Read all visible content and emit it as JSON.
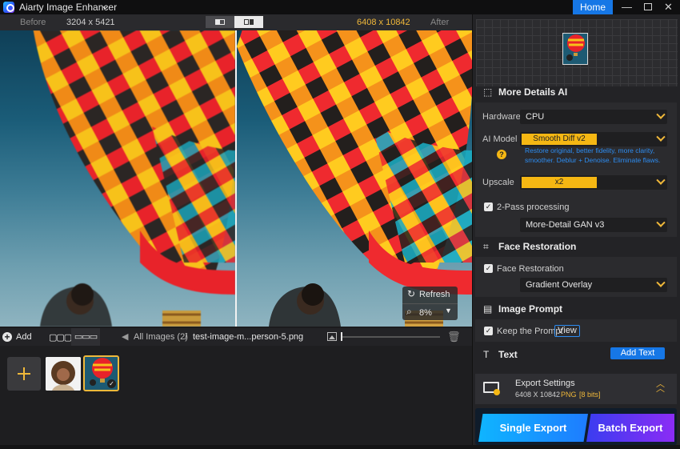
{
  "window": {
    "title": "Aiarty Image Enhancer",
    "home_label": "Home",
    "min_glyph": "—",
    "close_glyph": "✕"
  },
  "compare": {
    "before_label": "Before",
    "before_size": "3204 x 5421",
    "after_size": "6408 x 10842",
    "after_label": "After"
  },
  "preview_overlay": {
    "refresh_label": "Refresh",
    "zoom_level": "8%"
  },
  "toolbar": {
    "add_label": "Add",
    "breadcrumb_root": "All Images (2)",
    "breadcrumb_sep": "/",
    "file_name": "test-image-m...person-5.png"
  },
  "panel": {
    "more_details": {
      "title": "More Details AI",
      "hardware_label": "Hardware",
      "hardware_value": "CPU",
      "ai_model_label": "AI Model",
      "ai_model_value": "Smooth Diff  v2",
      "ai_model_desc": "Restore original, better fidelity, more clarity, smoother. Deblur + Denoise. Eliminate flaws.",
      "upscale_label": "Upscale",
      "upscale_value": "x2",
      "two_pass_label": "2-Pass processing",
      "two_pass_checked": true,
      "two_pass_model": "More-Detail GAN  v3"
    },
    "face_restoration": {
      "title": "Face Restoration",
      "checkbox_label": "Face Restoration",
      "checked": true,
      "mode_value": "Gradient Overlay"
    },
    "image_prompt": {
      "title": "Image Prompt",
      "keep_label": "Keep the Prompt",
      "checked": true,
      "view_label": "View"
    },
    "text": {
      "title": "Text",
      "add_label": "Add Text"
    },
    "export": {
      "settings_title": "Export Settings",
      "size": "6408 X 10842",
      "format": "PNG",
      "bits": "[8 bits]",
      "single_label": "Single Export",
      "batch_label": "Batch Export"
    }
  },
  "colors": {
    "accent_blue": "#1677e6",
    "accent_yellow": "#f5b713",
    "link_blue": "#2d8cf0"
  }
}
